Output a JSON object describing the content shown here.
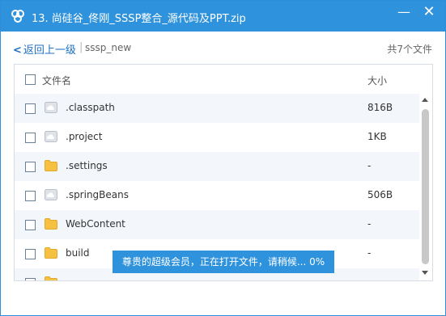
{
  "window": {
    "title": "13. 尚硅谷_佟刚_SSSP整合_源代码及PPT.zip",
    "min_symbol": "—",
    "close_symbol": "✕",
    "accent_color": "#2f92dc"
  },
  "nav": {
    "back_label": "返回上一级",
    "separator": "|",
    "current_folder": "sssp_new",
    "file_count": "共7个文件"
  },
  "columns": {
    "name": "文件名",
    "size": "大小"
  },
  "files": [
    {
      "name": ".classpath",
      "size": "816B",
      "icon": "file-icon"
    },
    {
      "name": ".project",
      "size": "1KB",
      "icon": "file-icon"
    },
    {
      "name": ".settings",
      "size": "-",
      "icon": "folder-icon"
    },
    {
      "name": ".springBeans",
      "size": "506B",
      "icon": "file-icon"
    },
    {
      "name": "WebContent",
      "size": "-",
      "icon": "folder-icon"
    },
    {
      "name": "build",
      "size": "-",
      "icon": "folder-icon"
    },
    {
      "name": "",
      "size": "",
      "icon": "folder-icon"
    }
  ],
  "toast": {
    "message": "尊贵的超级会员，正在打开文件，请稍候... 0%"
  }
}
